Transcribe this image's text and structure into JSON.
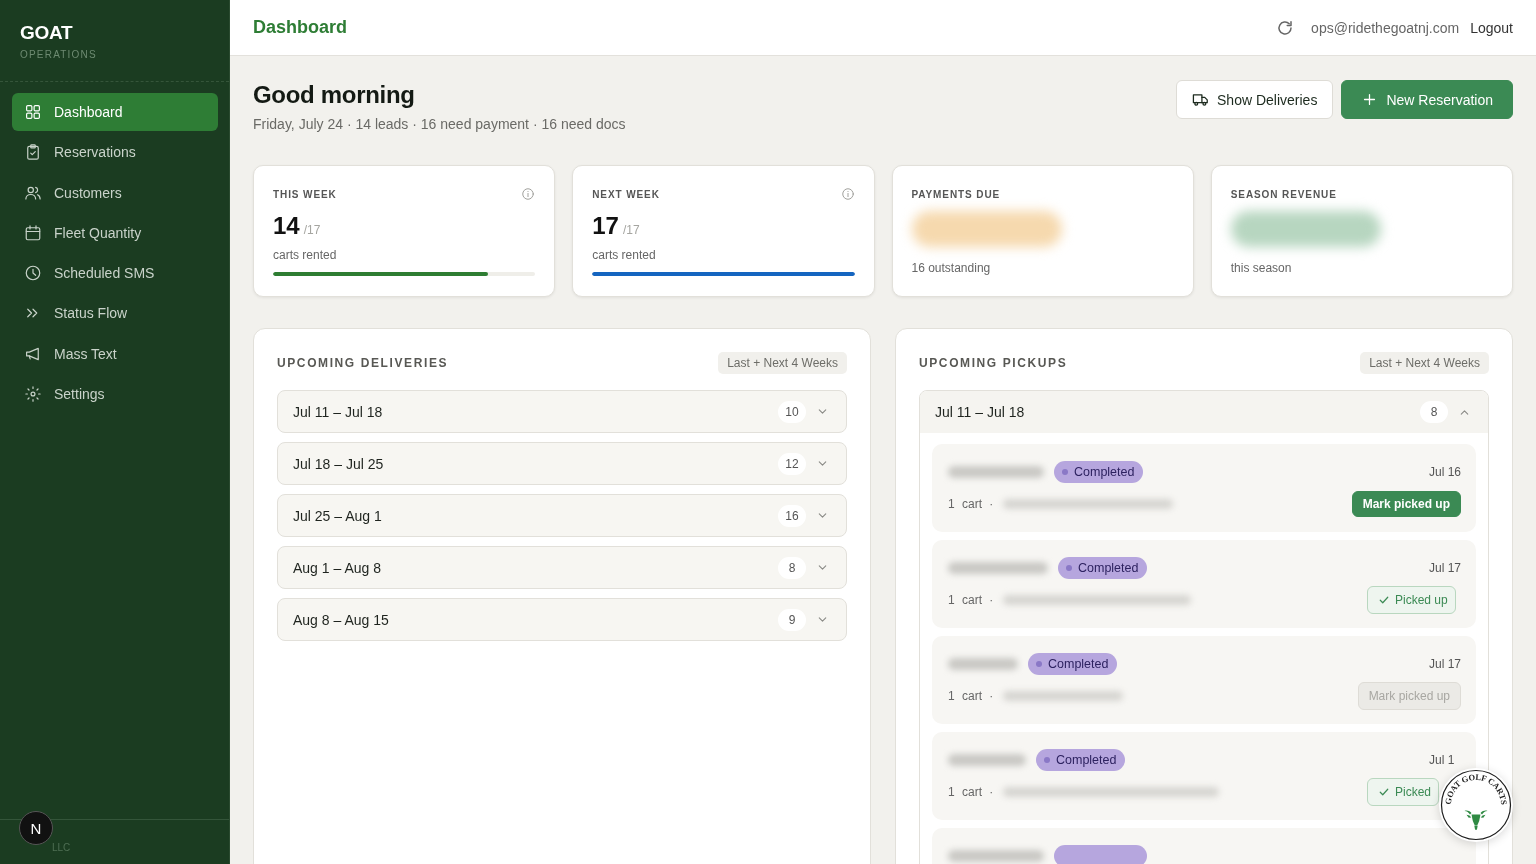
{
  "sidebar": {
    "brand": "GOAT",
    "subtitle": "OPERATIONS",
    "items": [
      {
        "label": "Dashboard",
        "selected": true
      },
      {
        "label": "Reservations",
        "selected": false
      },
      {
        "label": "Customers",
        "selected": false
      },
      {
        "label": "Fleet Quantity",
        "selected": false
      },
      {
        "label": "Scheduled SMS",
        "selected": false
      },
      {
        "label": "Status Flow",
        "selected": false
      },
      {
        "label": "Mass Text",
        "selected": false
      },
      {
        "label": "Settings",
        "selected": false
      }
    ],
    "footer": "LLC",
    "dev_badge": "N"
  },
  "topbar": {
    "title": "Dashboard",
    "email": "ops@ridethegoatnj.com",
    "logout": "Logout"
  },
  "greeting": {
    "title": "Good morning",
    "summary": "Friday, July 24 · 14 leads · 16 need payment · 16 need docs"
  },
  "actions": [
    {
      "kind": "secondary",
      "label": "Show Deliveries"
    },
    {
      "kind": "primary",
      "label": "New Reservation"
    }
  ],
  "stats": [
    {
      "kind": "progress",
      "label": "THIS WEEK",
      "value": "14",
      "total": "/17",
      "caption": "carts rented",
      "level": 0.82,
      "color": "#2e7d32"
    },
    {
      "kind": "progress",
      "label": "NEXT WEEK",
      "value": "17",
      "total": "/17",
      "caption": "carts rented",
      "level": 1,
      "color": "#1565c0"
    },
    {
      "kind": "hidden",
      "label": "PAYMENTS DUE",
      "caption": "16 outstanding",
      "color": "#f6d9ae"
    },
    {
      "kind": "hidden",
      "label": "SEASON REVENUE",
      "caption": "this season",
      "color": "#b7d6c0"
    }
  ],
  "deliveries": {
    "title": "UPCOMING DELIVERIES",
    "range_label": "Last + Next 4 Weeks",
    "weeks": [
      {
        "range": "Jul 11 – Jul 18",
        "count": "10",
        "expanded": false
      },
      {
        "range": "Jul 18 – Jul 25",
        "count": "12",
        "expanded": false
      },
      {
        "range": "Jul 25 – Aug 1",
        "count": "16",
        "expanded": false
      },
      {
        "range": "Aug 1 – Aug 8",
        "count": "8",
        "expanded": false
      },
      {
        "range": "Aug 8 – Aug 15",
        "count": "9",
        "expanded": false
      }
    ]
  },
  "pickups": {
    "title": "UPCOMING PICKUPS",
    "range_label": "Last + Next 4 Weeks",
    "weeks": [
      {
        "range": "Jul 11 – Jul 18",
        "count": "8",
        "expanded": true,
        "items": [
          {
            "kind": "entry",
            "status": "Completed",
            "date": "Jul 16",
            "carts": "1 cart ·",
            "action": {
              "kind": "mark",
              "label": "Mark picked up",
              "disabled": false
            }
          },
          {
            "kind": "entry",
            "status": "Completed",
            "date": "Jul 17",
            "carts": "1 cart ·",
            "action": {
              "kind": "done",
              "label": "Picked up",
              "disabled": false
            }
          },
          {
            "kind": "entry",
            "status": "Completed",
            "date": "Jul 17",
            "carts": "1 cart ·",
            "action": {
              "kind": "mark",
              "label": "Mark picked up",
              "disabled": true
            }
          },
          {
            "kind": "entry",
            "status": "Completed",
            "date": "Jul 1",
            "carts": "1 cart ·",
            "action": {
              "kind": "done",
              "label": "Picked",
              "disabled": false
            }
          },
          {
            "kind": "cut_off"
          }
        ]
      }
    ]
  },
  "logo_badge": {
    "text": "GOAT GOLF CARTS"
  }
}
